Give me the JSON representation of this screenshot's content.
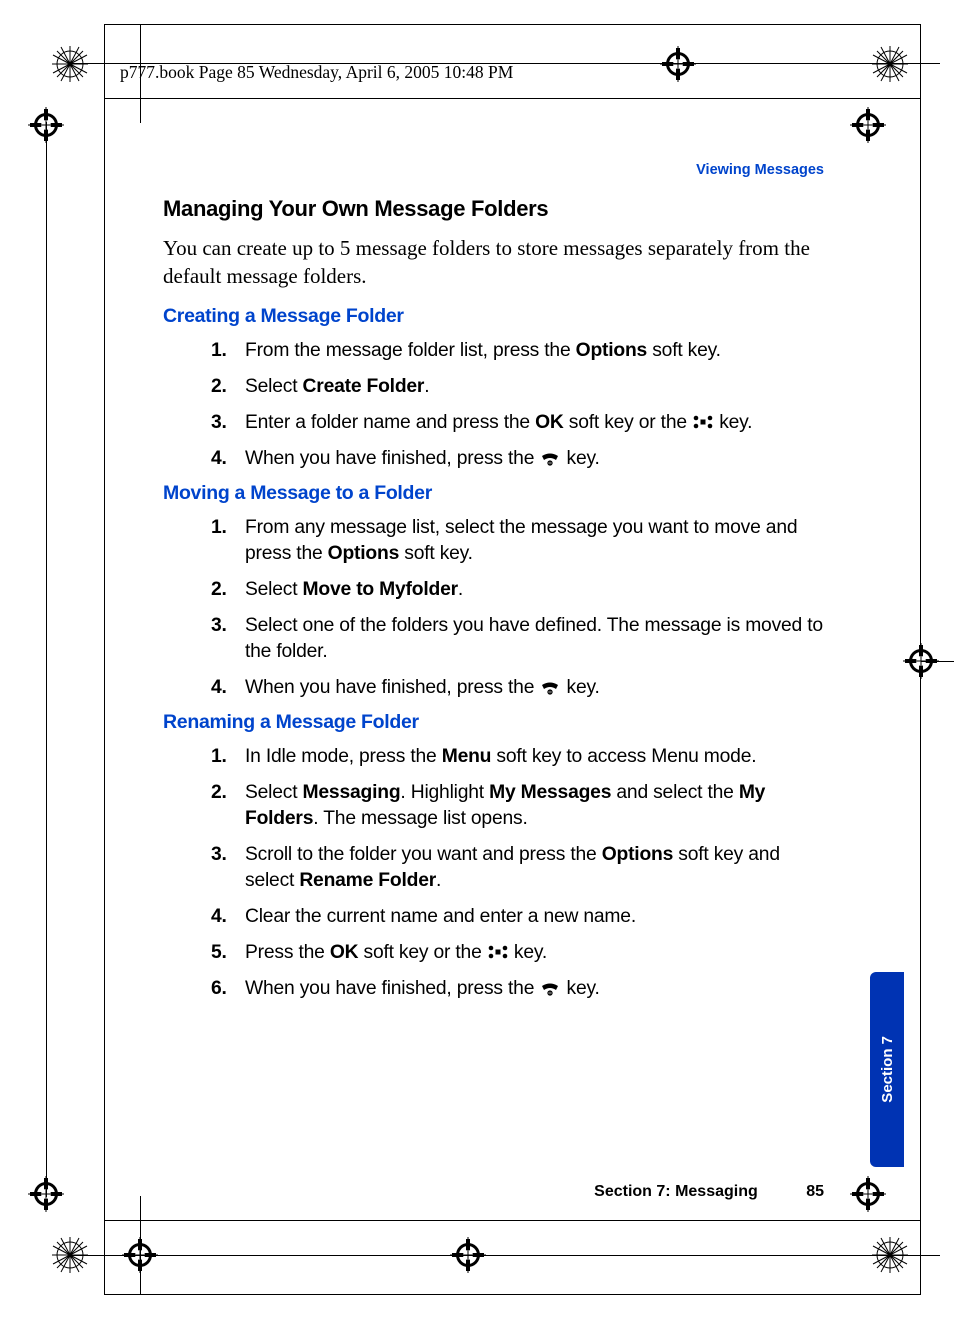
{
  "header": "p777.book  Page 85  Wednesday, April 6, 2005  10:48 PM",
  "sectionHeader": "Viewing Messages",
  "title": "Managing Your Own Message Folders",
  "intro": "You can create up to 5 message folders to store messages separately from the default message folders.",
  "sub1": "Creating a Message Folder",
  "s1": {
    "i1a": "From the message folder list, press the ",
    "i1b": "Options",
    "i1c": " soft key.",
    "i2a": "Select ",
    "i2b": "Create Folder",
    "i2c": ".",
    "i3a": "Enter a folder name and press the ",
    "i3b": "OK",
    "i3c": " soft key or the ",
    "i3d": " key.",
    "i4a": "When you have finished, press the ",
    "i4b": " key."
  },
  "sub2": "Moving a Message to a Folder",
  "s2": {
    "i1a": "From any message list, select the message you want to move and press the ",
    "i1b": "Options",
    "i1c": " soft key.",
    "i2a": "Select ",
    "i2b": "Move to Myfolder",
    "i2c": ".",
    "i3": "Select one of the folders you have defined. The message is moved to the folder.",
    "i4a": "When you have finished, press the ",
    "i4b": " key."
  },
  "sub3": "Renaming a Message Folder",
  "s3": {
    "i1a": "In Idle mode, press the ",
    "i1b": "Menu",
    "i1c": " soft key to access Menu mode.",
    "i2a": "Select ",
    "i2b": "Messaging",
    "i2c": ". Highlight ",
    "i2d": "My Messages",
    "i2e": " and select the ",
    "i2f": "My Folders",
    "i2g": ". The message list opens.",
    "i3a": "Scroll to the folder you want and press the ",
    "i3b": "Options",
    "i3c": " soft key and select ",
    "i3d": "Rename Folder",
    "i3e": ".",
    "i4": "Clear the current name and enter a new name.",
    "i5a": "Press the ",
    "i5b": "OK",
    "i5c": " soft key or the ",
    "i5d": " key.",
    "i6a": "When you have finished, press the ",
    "i6b": " key."
  },
  "footerSection": "Section 7: Messaging",
  "footerPage": "85",
  "sideTab": "Section 7",
  "nums": {
    "n1": "1.",
    "n2": "2.",
    "n3": "3.",
    "n4": "4.",
    "n5": "5.",
    "n6": "6."
  }
}
